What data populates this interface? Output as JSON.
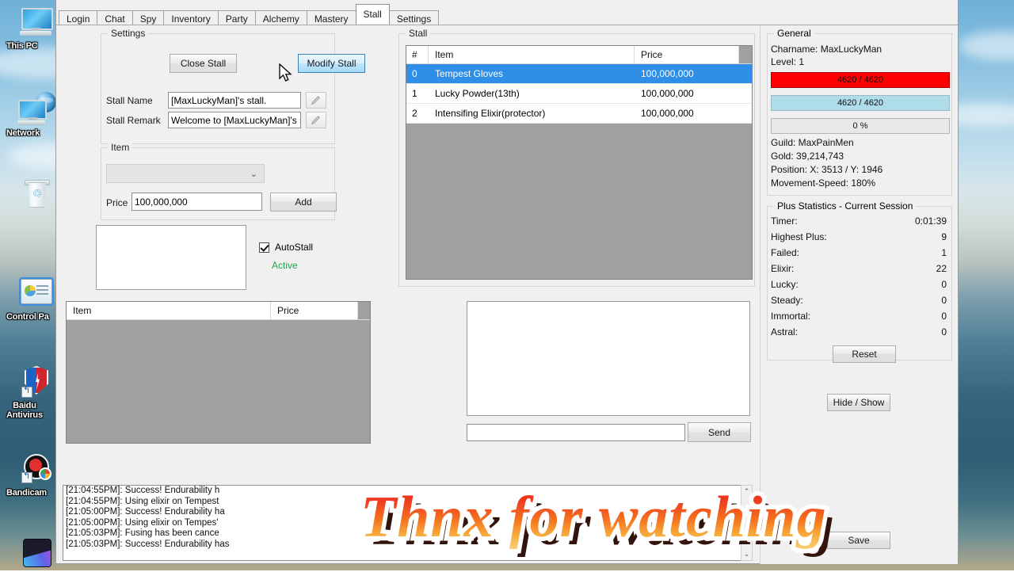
{
  "desktop": {
    "icons": [
      {
        "name": "this-pc",
        "label": "This PC"
      },
      {
        "name": "network",
        "label": "Network"
      },
      {
        "name": "recycle-bin",
        "label": ""
      },
      {
        "name": "control-panel",
        "label": "Control Pa"
      },
      {
        "name": "baidu-antivirus",
        "label": "Baidu\nAntivirus"
      },
      {
        "name": "bandicam",
        "label": "Bandicam"
      }
    ]
  },
  "watermark": {
    "text": "Thnx for watching"
  },
  "tabs": [
    {
      "label": "Login",
      "active": false
    },
    {
      "label": "Chat",
      "active": false
    },
    {
      "label": "Spy",
      "active": false
    },
    {
      "label": "Inventory",
      "active": false
    },
    {
      "label": "Party",
      "active": false
    },
    {
      "label": "Alchemy",
      "active": false
    },
    {
      "label": "Mastery",
      "active": false
    },
    {
      "label": "Stall",
      "active": true
    },
    {
      "label": "Settings",
      "active": false
    }
  ],
  "settings_group": {
    "title": "Settings",
    "close_stall_button": "Close Stall",
    "modify_stall_button": "Modify Stall",
    "stall_name_label": "Stall Name",
    "stall_name_value": "[MaxLuckyMan]'s stall.",
    "stall_remark_label": "Stall Remark",
    "stall_remark_value": "Welcome to [MaxLuckyMan]'s s"
  },
  "item_group": {
    "title": "Item",
    "combo_value": "",
    "price_label": "Price",
    "price_value": "100,000,000",
    "add_button": "Add"
  },
  "autostall": {
    "label": "AutoStall",
    "status": "Active",
    "status_color": "#21a04a",
    "checked": true
  },
  "stall_group": {
    "title": "Stall",
    "columns": [
      "#",
      "Item",
      "Price"
    ],
    "rows": [
      {
        "num": "0",
        "item": "Tempest Gloves",
        "price": "100,000,000",
        "selected": true
      },
      {
        "num": "1",
        "item": "Lucky Powder(13th)",
        "price": "100,000,000",
        "selected": false
      },
      {
        "num": "2",
        "item": "Intensifing Elixir(protector)",
        "price": "100,000,000",
        "selected": false
      }
    ]
  },
  "bottom_list": {
    "columns": [
      "Item",
      "Price"
    ],
    "rows": []
  },
  "chat": {
    "input_value": "",
    "send_button": "Send"
  },
  "sidebar": {
    "general": {
      "title": "General",
      "charname": "Charname: MaxLuckyMan",
      "level": "Level: 1",
      "hp_text": "4620 / 4620",
      "hp_color": "#FF0000",
      "mp_text": "4620 / 4620",
      "mp_color": "#AEDCE8",
      "exp_text": "0 %",
      "exp_color": "#E8E8E8",
      "guild": "Guild: MaxPainMen",
      "gold": "Gold: 39,214,743",
      "position": "Position: X: 3513 / Y: 1946",
      "movement_speed": "Movement-Speed: 180%"
    },
    "plus_statistics": {
      "title": "Plus Statistics - Current Session",
      "rows": [
        {
          "label": "Timer:",
          "value": "0:01:39"
        },
        {
          "label": "Highest Plus:",
          "value": "9"
        },
        {
          "label": "Failed:",
          "value": "1"
        },
        {
          "label": "Elixir:",
          "value": "22"
        },
        {
          "label": "Lucky:",
          "value": "0"
        },
        {
          "label": "Steady:",
          "value": "0"
        },
        {
          "label": "Immortal:",
          "value": "0"
        },
        {
          "label": "Astral:",
          "value": "0"
        }
      ],
      "reset_button": "Reset"
    },
    "hide_show_button": "Hide / Show",
    "save_button": "Save"
  },
  "log": {
    "lines": [
      "[21:04:55PM]: Success! Endurability h",
      "[21:04:55PM]: Using elixir on Tempest",
      "[21:05:00PM]: Success! Endurability ha",
      "[21:05:00PM]: Using elixir on Tempes'",
      "[21:05:03PM]: Fusing has been cance",
      "[21:05:03PM]: Success! Endurability has"
    ]
  }
}
